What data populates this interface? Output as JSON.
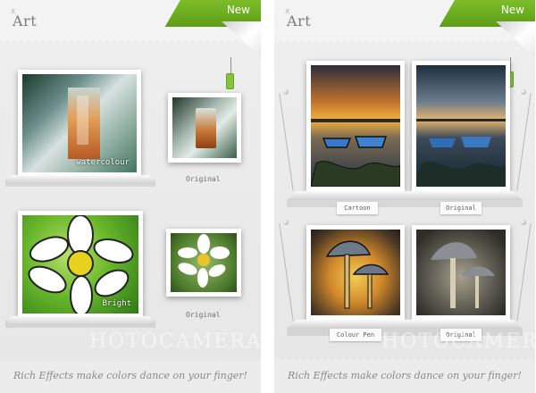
{
  "colors": {
    "accent_green": "#6aab1e",
    "panel_bg": "#e9e9e9"
  },
  "panels": [
    {
      "title": "Art",
      "title_mark": "x",
      "badge": "New",
      "left_items": [
        {
          "caption": "watercolour",
          "original_label": "Original"
        },
        {
          "caption": "Bright",
          "original_label": "Original"
        }
      ],
      "watermark": "HOTOCAMERA",
      "tagline": "Rich Effects make colors dance on your finger!"
    },
    {
      "title": "Art",
      "title_mark": "x",
      "badge": "New",
      "cards": [
        {
          "label": "Cartoon"
        },
        {
          "label": "Original"
        },
        {
          "label": "Colour Pen"
        },
        {
          "label": "Original"
        }
      ],
      "watermark": "HOTOCAMERA",
      "tagline": "Rich Effects make colors dance on your finger!"
    }
  ]
}
